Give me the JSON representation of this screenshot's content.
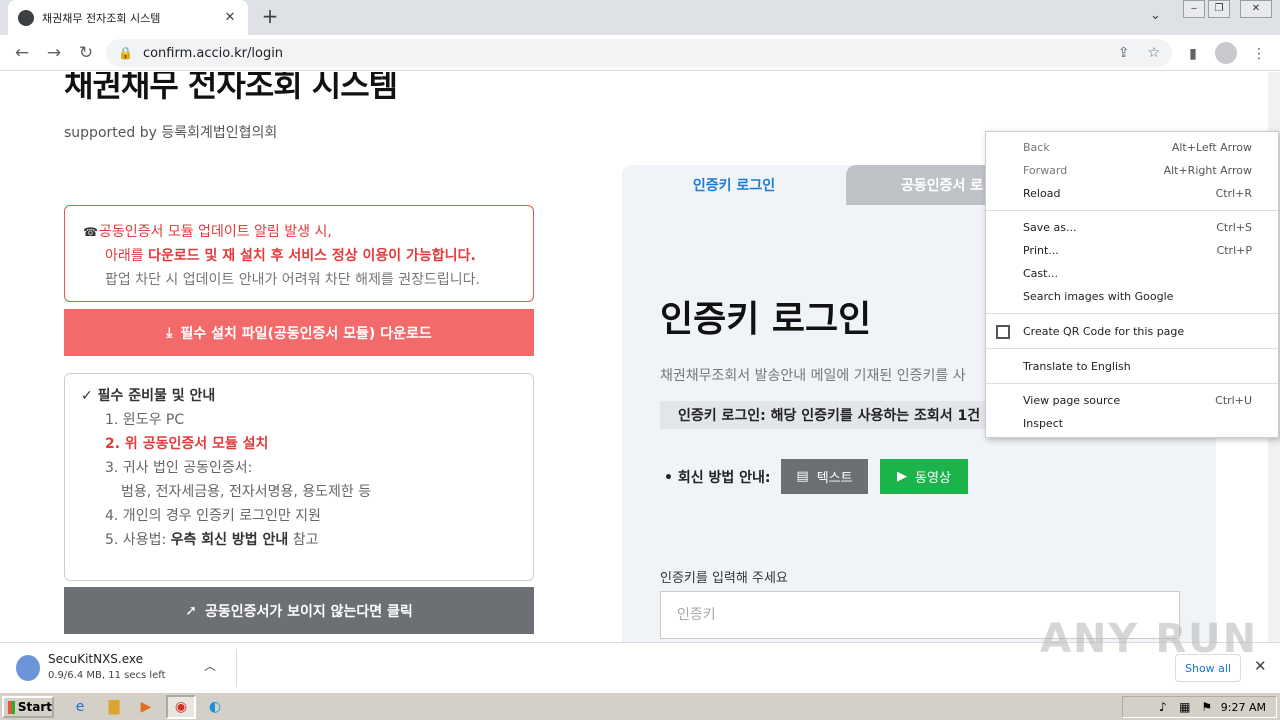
{
  "browser": {
    "tab_title": "채권채무 전자조회 시스템",
    "url": "confirm.accio.kr/login",
    "new_tab": "+",
    "tab_close": "✕"
  },
  "page": {
    "site_title": "채권채무 전자조회 시스템",
    "supported_by": "supported by 등록회계법인협의회",
    "notice": {
      "line1": "공동인증서 모듈 업데이트 알림 발생 시,",
      "line2_prefix": "아래를 ",
      "line2_bold": "다운로드 및 재 설치 후 서비스 정상 이용이 가능합니다.",
      "line3": "팝업 차단 시 업데이트 안내가 어려워 차단 해제를 권장드립니다."
    },
    "download_button": "필수 설치 파일(공동인증서 모듈) 다운로드",
    "guide": {
      "heading": "필수 준비물 및 안내",
      "item1": "1. 윈도우 PC",
      "item2": "2. 위 공동인증서 모듈 설치",
      "item3": "3. 귀사 법인 공동인증서:",
      "item3_sub": "범용, 전자세금용, 전자서명용, 용도제한 등",
      "item4": "4. 개인의 경우 인증키 로그인만 지원",
      "item5_prefix": "5. 사용법: ",
      "item5_bold": "우측 회신 방법 안내",
      "item5_suffix": " 참고"
    },
    "cert_button": "공동인증서가 보이지 않는다면 클릭"
  },
  "login": {
    "tab_key": "인증키 로그인",
    "tab_cert": "공동인증서 로",
    "title": "인증키 로그인",
    "desc": "채권채무조회서 발송안내 메일에 기재된 인증키를 사",
    "strip": "인증키 로그인: 해당 인증키를 사용하는 조회서 1건",
    "reply_label": "• 회신 방법 안내:",
    "btn_text": "텍스트",
    "btn_video": "동영상",
    "key_label": "인증키를 입력해 주세요",
    "key_placeholder": "인증키"
  },
  "context_menu": {
    "back": "Back",
    "back_sc": "Alt+Left Arrow",
    "forward": "Forward",
    "forward_sc": "Alt+Right Arrow",
    "reload": "Reload",
    "reload_sc": "Ctrl+R",
    "save_as": "Save as...",
    "save_as_sc": "Ctrl+S",
    "print": "Print...",
    "print_sc": "Ctrl+P",
    "cast": "Cast...",
    "search_images": "Search images with Google",
    "qr": "Create QR Code for this page",
    "translate": "Translate to English",
    "view_source": "View page source",
    "view_source_sc": "Ctrl+U",
    "inspect": "Inspect"
  },
  "download_bar": {
    "file_name": "SecuKitNXS.exe",
    "status": "0.9/6.4 MB, 11 secs left",
    "show_all": "Show all"
  },
  "taskbar": {
    "start": "Start",
    "clock": "9:27 AM"
  },
  "watermark": "ANY RUN"
}
